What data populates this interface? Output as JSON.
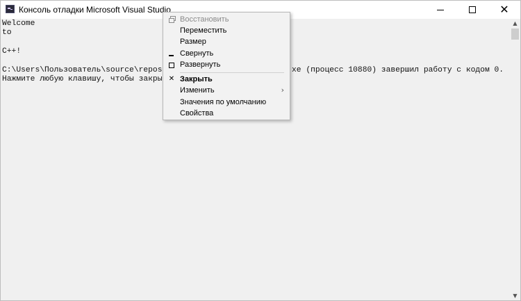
{
  "window": {
    "title": "Консоль отладки Microsoft Visual Studio",
    "icon": "visual-studio-console-icon",
    "caption_buttons": {
      "minimize": "minimize-icon",
      "maximize": "maximize-icon",
      "close": "✕"
    }
  },
  "console": {
    "lines": [
      "Welcome",
      "to",
      "",
      "C++!",
      "",
      "C:\\Users\\Пользователь\\source\\repos\\Wel",
      "Нажмите любую клавишу, чтобы закрыть э"
    ],
    "line5_tail": "xe (процесс 10880) завершил работу с кодом 0."
  },
  "system_menu": {
    "items": [
      {
        "label": "Восстановить",
        "icon": "restore-icon",
        "enabled": false
      },
      {
        "label": "Переместить",
        "icon": "",
        "enabled": true
      },
      {
        "label": "Размер",
        "icon": "",
        "enabled": true
      },
      {
        "label": "Свернуть",
        "icon": "minimize-icon",
        "enabled": true
      },
      {
        "label": "Развернуть",
        "icon": "maximize-icon",
        "enabled": true
      },
      {
        "label": "Закрыть",
        "icon": "close-icon",
        "enabled": true,
        "default": true
      },
      {
        "label": "Изменить",
        "icon": "",
        "enabled": true,
        "submenu": true
      },
      {
        "label": "Значения по умолчанию",
        "icon": "",
        "enabled": true
      },
      {
        "label": "Свойства",
        "icon": "",
        "enabled": true
      }
    ],
    "close_mark": "✕",
    "submenu_arrow": "›"
  },
  "scrollbar": {
    "up_arrow": "▲",
    "down_arrow": "▼"
  }
}
